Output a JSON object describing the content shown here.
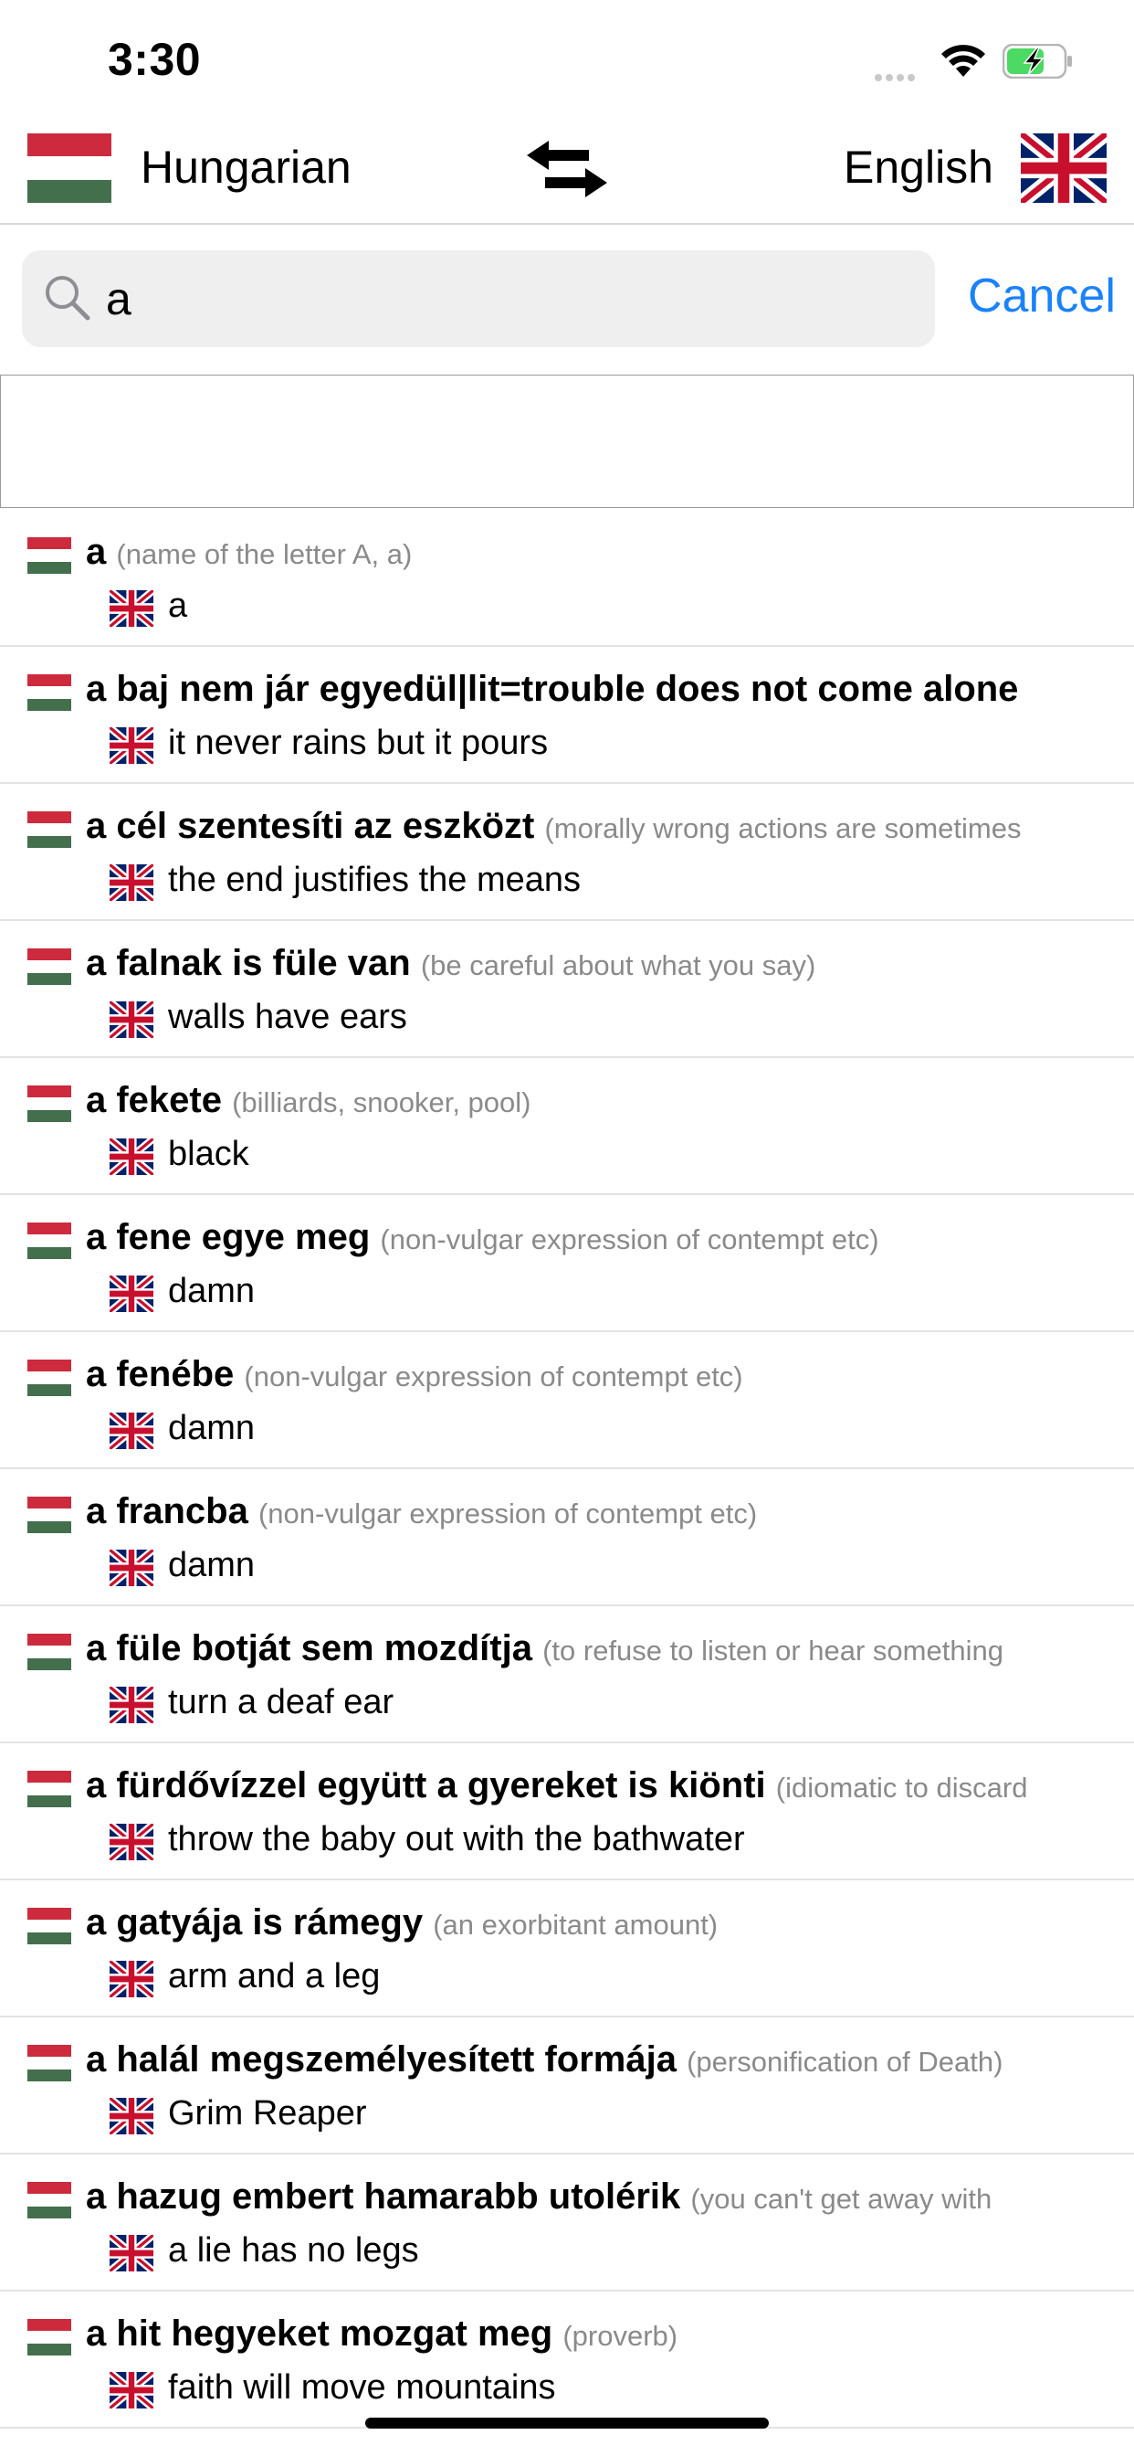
{
  "status": {
    "time": "3:30"
  },
  "header": {
    "source_language": "Hungarian",
    "target_language": "English"
  },
  "search": {
    "query": "a",
    "cancel_label": "Cancel"
  },
  "colors": {
    "accent": "#1a82fb",
    "hu_red": "#cd2a3e",
    "hu_green": "#436f4d",
    "gb_blue": "#012169",
    "gb_red": "#c8102e"
  },
  "results": [
    {
      "term": "a",
      "note": "(name of the letter A, a)",
      "translation": "a"
    },
    {
      "term": "a baj nem jár egyedül|lit=trouble does not come alone",
      "note": "",
      "translation": "it never rains but it pours"
    },
    {
      "term": "a cél szentesíti az eszközt",
      "note": "(morally wrong actions are sometimes",
      "translation": "the end justifies the means"
    },
    {
      "term": "a falnak is füle van",
      "note": "(be careful about what you say)",
      "translation": "walls have ears"
    },
    {
      "term": "a fekete",
      "note": "(billiards, snooker, pool)",
      "translation": "black"
    },
    {
      "term": "a fene egye meg",
      "note": "(non-vulgar expression of contempt etc)",
      "translation": "damn"
    },
    {
      "term": "a fenébe",
      "note": "(non-vulgar expression of contempt etc)",
      "translation": "damn"
    },
    {
      "term": "a francba",
      "note": "(non-vulgar expression of contempt etc)",
      "translation": "damn"
    },
    {
      "term": "a füle botját sem mozdítja",
      "note": "(to refuse to listen or hear something",
      "translation": "turn a deaf ear"
    },
    {
      "term": "a fürdővízzel együtt a gyereket is kiönti",
      "note": "(idiomatic to discard",
      "translation": "throw the baby out with the bathwater"
    },
    {
      "term": "a gatyája is rámegy",
      "note": "(an exorbitant amount)",
      "translation": "arm and a leg"
    },
    {
      "term": "a halál megszemélyesített formája",
      "note": "(personification of Death)",
      "translation": "Grim Reaper"
    },
    {
      "term": "a hazug embert hamarabb utolérik",
      "note": "(you can't get away with",
      "translation": "a lie has no legs"
    },
    {
      "term": "a hit hegyeket mozgat meg",
      "note": "(proverb)",
      "translation": "faith will move mountains"
    }
  ]
}
